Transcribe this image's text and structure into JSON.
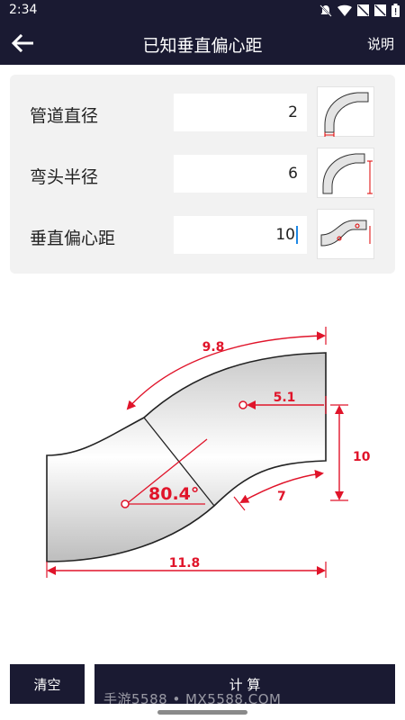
{
  "status_bar": {
    "time": "2:34"
  },
  "app_bar": {
    "title": "已知垂直偏心距",
    "help": "说明"
  },
  "fields": [
    {
      "label": "管道直径",
      "value": "2"
    },
    {
      "label": "弯头半径",
      "value": "6"
    },
    {
      "label": "垂直偏心距",
      "value": "10"
    }
  ],
  "diagram": {
    "arc_length_outer": "9.8",
    "horizontal_offset": "5.1",
    "vertical_offset": "10",
    "angle": "80.4°",
    "arc_length_inner": "7",
    "total_length": "11.8",
    "accent_color": "#e0142a"
  },
  "buttons": {
    "clear": "清空",
    "calculate": "计 算"
  },
  "watermark": "手游5588 • MX5588.COM"
}
